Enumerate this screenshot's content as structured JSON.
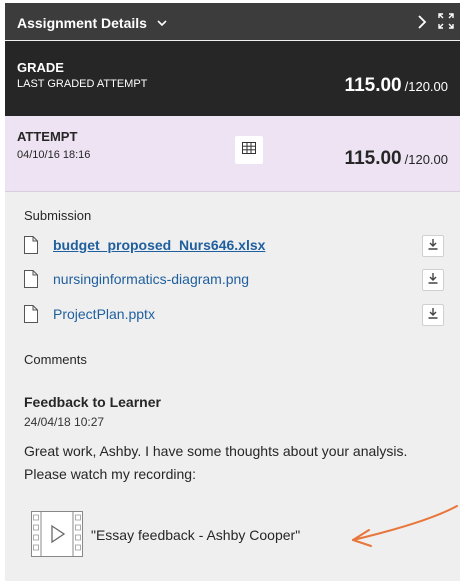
{
  "header": {
    "title": "Assignment Details",
    "icons": {
      "dropdown": "chevron-down-icon",
      "next": "chevron-right-icon",
      "expand": "expand-icon"
    }
  },
  "grade": {
    "title": "GRADE",
    "subtitle": "LAST GRADED ATTEMPT",
    "score": "115.00",
    "max": "/120.00"
  },
  "attempt": {
    "title": "ATTEMPT",
    "date": "04/10/16 18:16",
    "score": "115.00",
    "max": "/120.00",
    "icons": {
      "rubric": "rubric-grid-icon"
    }
  },
  "submission": {
    "label": "Submission",
    "files": [
      {
        "name": "budget_proposed_Nurs646.xlsx"
      },
      {
        "name": "nursinginformatics-diagram.png"
      },
      {
        "name": "ProjectPlan.pptx"
      }
    ]
  },
  "comments": {
    "label": "Comments",
    "feedback_title": "Feedback to Learner",
    "feedback_date": "24/04/18 10:27",
    "feedback_text": "Great work, Ashby. I have some thoughts about your analysis. Please watch my recording:",
    "recording_label": "\"Essay feedback - Ashby Cooper\""
  },
  "colors": {
    "header_bg": "#3c3c3c",
    "grade_bg": "#262626",
    "attempt_bg": "#ede3f2",
    "panel_bg": "#efefef",
    "link": "#1f5f9e",
    "arrow": "#e8763a"
  }
}
